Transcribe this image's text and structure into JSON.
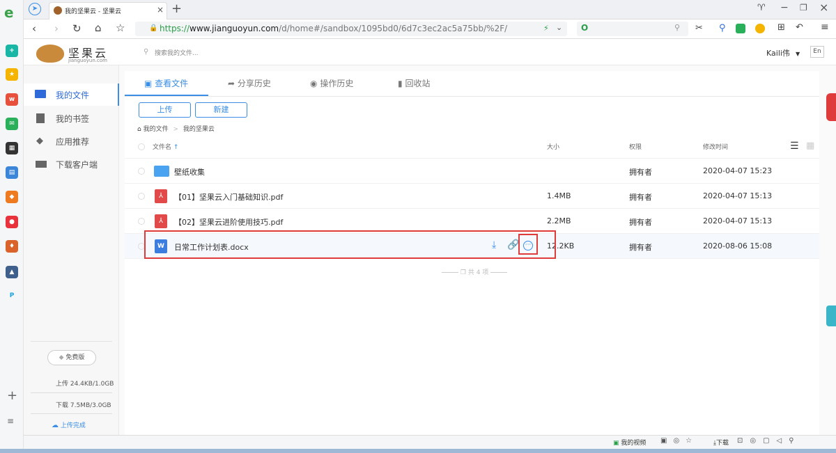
{
  "browser": {
    "tab_title": "我的坚果云 - 坚果云",
    "url_scheme": "https://",
    "url_host": "www.jianguoyun.com",
    "url_path": "/d/home#/sandbox/1095bd0/6d7c3ec2ac5a75bb/%2F/"
  },
  "app": {
    "logo_text": "坚果云",
    "logo_sub": "jianguoyun.com",
    "search_placeholder": "搜索我的文件...",
    "user": "Kaili伟",
    "lang": "En"
  },
  "sidebar": {
    "items": [
      {
        "label": "我的文件",
        "active": true
      },
      {
        "label": "我的书签"
      },
      {
        "label": "应用推荐"
      },
      {
        "label": "下载客户端"
      }
    ],
    "plan": "免费版",
    "upload_quota": "上传 24.4KB/1.0GB",
    "download_quota": "下载 7.5MB/3.0GB",
    "upload_status": "上传完成"
  },
  "tabs": [
    {
      "label": "查看文件",
      "active": true
    },
    {
      "label": "分享历史"
    },
    {
      "label": "操作历史"
    },
    {
      "label": "回收站"
    }
  ],
  "actions": {
    "upload": "上传",
    "create": "新建"
  },
  "breadcrumb": {
    "root": "我的文件",
    "sep": ">",
    "current": "我的坚果云"
  },
  "table": {
    "headers": {
      "name": "文件名",
      "sort": "↑",
      "size": "大小",
      "perm": "权限",
      "mtime": "修改时间"
    },
    "rows": [
      {
        "type": "folder",
        "name": "壁纸收集",
        "size": "",
        "perm": "拥有者",
        "mtime": "2020-04-07 15:23"
      },
      {
        "type": "pdf",
        "name": "【01】坚果云入门基础知识.pdf",
        "size": "1.4MB",
        "perm": "拥有者",
        "mtime": "2020-04-07 15:13"
      },
      {
        "type": "pdf",
        "name": "【02】坚果云进阶使用技巧.pdf",
        "size": "2.2MB",
        "perm": "拥有者",
        "mtime": "2020-04-07 15:13"
      },
      {
        "type": "docx",
        "name": "日常工作计划表.docx",
        "size": "12.2KB",
        "perm": "拥有者",
        "mtime": "2020-08-06 15:08"
      }
    ],
    "footer": "共 4 项"
  },
  "status": {
    "video": "我的视频",
    "download": "下载"
  },
  "colors": {
    "accent": "#3a8ee6",
    "highlight": "#e03b3b"
  }
}
